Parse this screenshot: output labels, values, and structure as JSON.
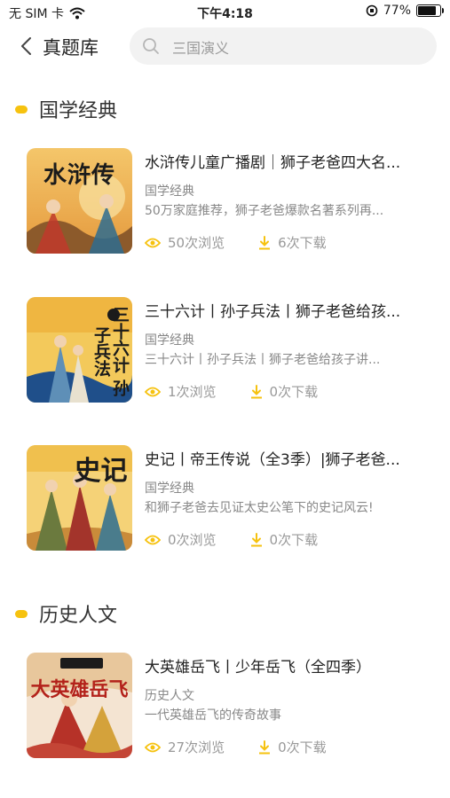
{
  "status_bar": {
    "carrier": "无 SIM 卡",
    "time": "下午4:18",
    "battery_percent": "77%",
    "battery_level": 0.77
  },
  "nav": {
    "title": "真题库",
    "search_value": "三国演义"
  },
  "sections": [
    {
      "title": "国学经典",
      "items": [
        {
          "title": "水浒传儿童广播剧｜狮子老爸四大名...",
          "category": "国学经典",
          "desc": "50万家庭推荐，狮子老爸爆款名著系列再...",
          "views": "50次浏览",
          "downloads": "6次下载",
          "cover_text": "水浒传"
        },
        {
          "title": "三十六计丨孙子兵法丨狮子老爸给孩...",
          "category": "国学经典",
          "desc": "三十六计丨孙子兵法丨狮子老爸给孩子讲...",
          "views": "1次浏览",
          "downloads": "0次下载",
          "cover_text": "三十六计 孙子兵法"
        },
        {
          "title": "史记丨帝王传说（全3季）|狮子老爸...",
          "category": "国学经典",
          "desc": "和狮子老爸去见证太史公笔下的史记风云!",
          "views": "0次浏览",
          "downloads": "0次下载",
          "cover_text": "史记"
        }
      ]
    },
    {
      "title": "历史人文",
      "items": [
        {
          "title": "大英雄岳飞丨少年岳飞（全四季）",
          "category": "历史人文",
          "desc": "一代英雄岳飞的传奇故事",
          "views": "27次浏览",
          "downloads": "0次下载",
          "cover_text": "大英雄岳飞"
        }
      ]
    }
  ],
  "colors": {
    "accent_yellow": "#f6c20f",
    "text_gray": "#888888"
  }
}
